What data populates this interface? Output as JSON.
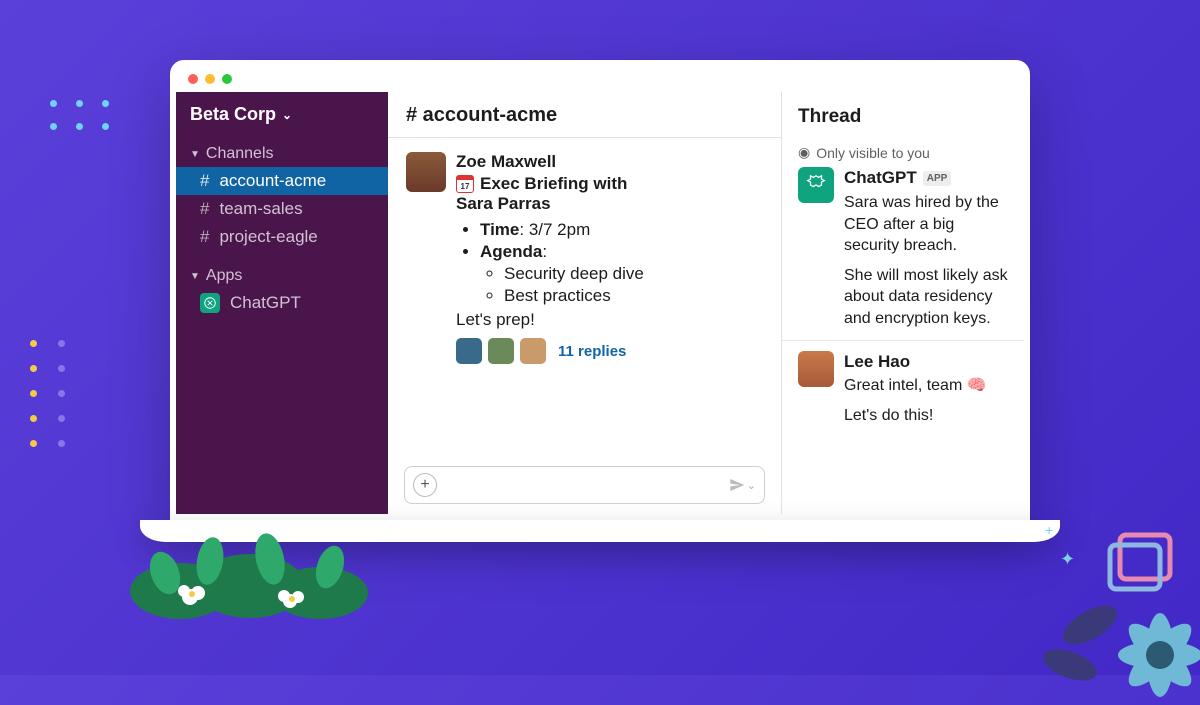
{
  "workspace": {
    "name": "Beta Corp"
  },
  "sidebar": {
    "channelsLabel": "Channels",
    "appsLabel": "Apps",
    "channels": [
      {
        "name": "account-acme",
        "active": true
      },
      {
        "name": "team-sales",
        "active": false
      },
      {
        "name": "project-eagle",
        "active": false
      }
    ],
    "apps": [
      {
        "name": "ChatGPT"
      }
    ]
  },
  "channel": {
    "name": "# account-acme",
    "message": {
      "author": "Zoe Maxwell",
      "calDay": "17",
      "titleLine": "Exec Briefing with",
      "titleLine2": "Sara Parras",
      "timeLabel": "Time",
      "timeValue": "3/7 2pm",
      "agendaLabel": "Agenda",
      "agendaItems": [
        "Security deep dive",
        "Best practices"
      ],
      "closing": "Let's prep!",
      "repliesCount": "11 replies"
    },
    "composerPlaceholder": ""
  },
  "thread": {
    "title": "Thread",
    "visibilityNote": "Only visible to you",
    "gpt": {
      "name": "ChatGPT",
      "badge": "APP",
      "p1": "Sara was hired by the CEO after a big security breach.",
      "p2": "She will most likely ask about data residency and encryption keys."
    },
    "reply": {
      "author": "Lee Hao",
      "line1": "Great intel, team 🧠",
      "line2": "Let's do this!"
    }
  }
}
